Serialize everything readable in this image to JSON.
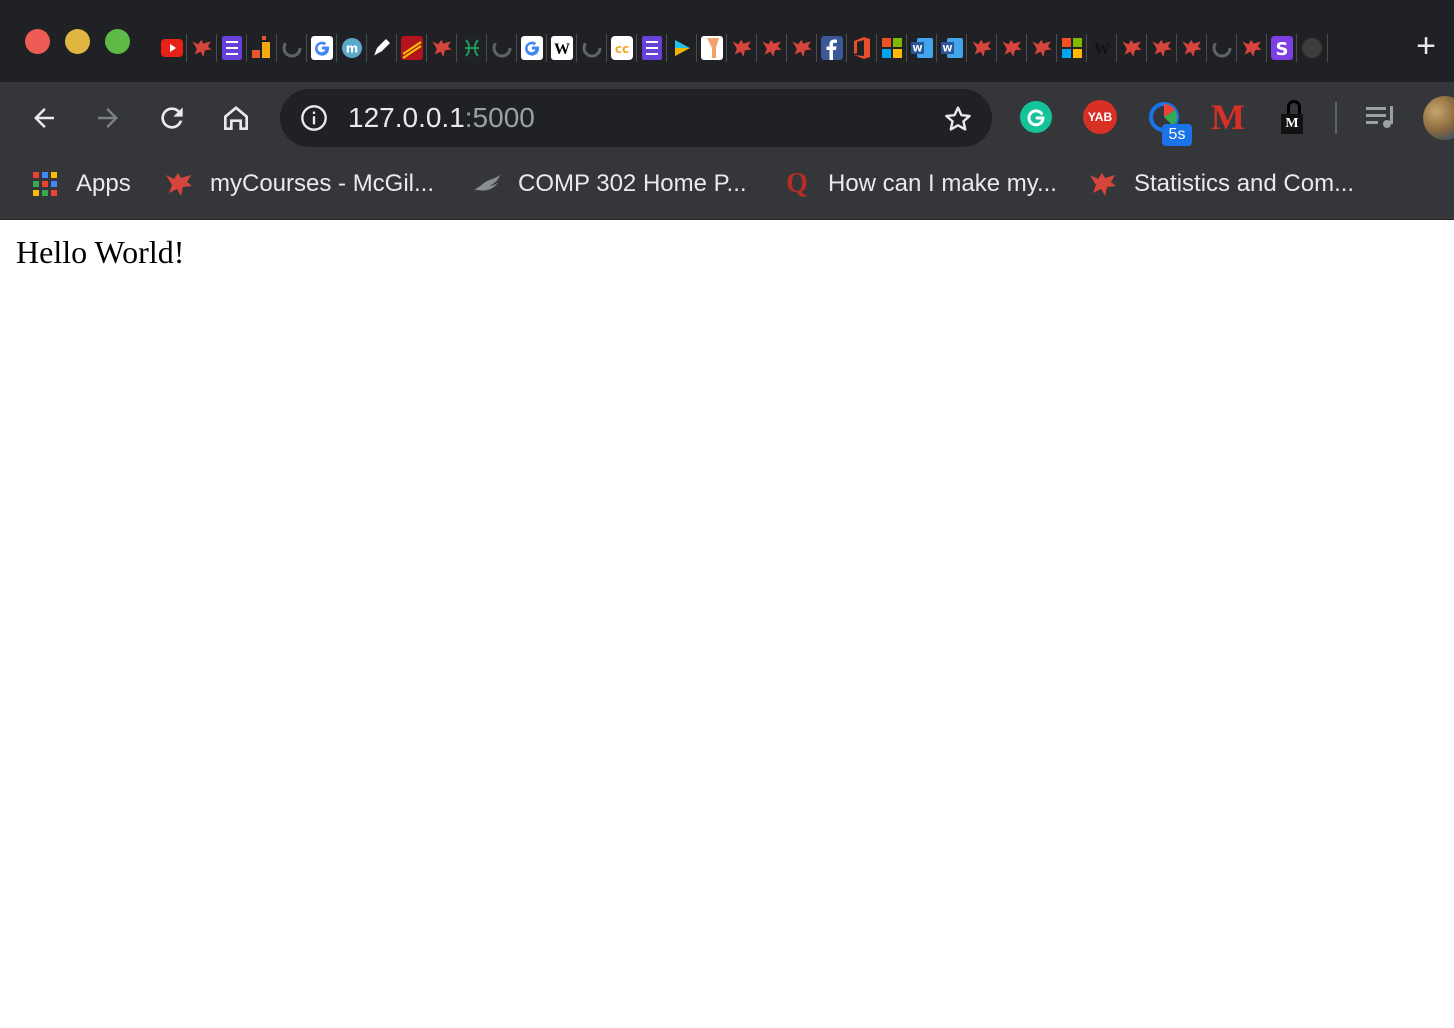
{
  "window": {
    "controls": [
      "close",
      "minimize",
      "zoom"
    ]
  },
  "tabs": [
    {
      "icon": "youtube-icon",
      "color": "#e62117"
    },
    {
      "icon": "mcgill-icon",
      "color": "#d6453c"
    },
    {
      "icon": "list-icon",
      "color": "#6741d9"
    },
    {
      "icon": "blocks-icon",
      "color": "#e4572e"
    },
    {
      "icon": "loading-icon",
      "color": "#5f6368"
    },
    {
      "icon": "google-icon",
      "color": "#4285f4"
    },
    {
      "icon": "m-circle-icon",
      "color": "#5aa9c8"
    },
    {
      "icon": "pen-icon",
      "color": "#ffffff"
    },
    {
      "icon": "cibc-icon",
      "color": "#b3141e"
    },
    {
      "icon": "mcgill-icon",
      "color": "#d6453c"
    },
    {
      "icon": "pisces-icon",
      "color": "#1f9c5a"
    },
    {
      "icon": "loading-icon",
      "color": "#5f6368"
    },
    {
      "icon": "google-icon",
      "color": "#4285f4"
    },
    {
      "icon": "wikipedia-icon",
      "color": "#ffffff"
    },
    {
      "icon": "loading-icon",
      "color": "#5f6368"
    },
    {
      "icon": "cc-icon",
      "color": "#f5a623"
    },
    {
      "icon": "list-icon",
      "color": "#6741d9"
    },
    {
      "icon": "play-icon",
      "color": "#22c3e6"
    },
    {
      "icon": "y-icon",
      "color": "#f4a26b"
    },
    {
      "icon": "mcgill-icon",
      "color": "#d6453c"
    },
    {
      "icon": "mcgill-icon",
      "color": "#d6453c"
    },
    {
      "icon": "mcgill-icon",
      "color": "#d6453c"
    },
    {
      "icon": "facebook-icon",
      "color": "#3b5998"
    },
    {
      "icon": "office-icon",
      "color": "#e4502a"
    },
    {
      "icon": "microsoft-icon",
      "color": "#f25022"
    },
    {
      "icon": "word-icon",
      "color": "#2b579a"
    },
    {
      "icon": "word-icon",
      "color": "#2b579a"
    },
    {
      "icon": "mcgill-icon",
      "color": "#d6453c"
    },
    {
      "icon": "mcgill-icon",
      "color": "#d6453c"
    },
    {
      "icon": "mcgill-icon",
      "color": "#d6453c"
    },
    {
      "icon": "microsoft-icon",
      "color": "#f25022"
    },
    {
      "icon": "journal-icon",
      "color": "#111111"
    },
    {
      "icon": "mcgill-icon",
      "color": "#d6453c"
    },
    {
      "icon": "mcgill-icon",
      "color": "#d6453c"
    },
    {
      "icon": "mcgill-icon",
      "color": "#d6453c"
    },
    {
      "icon": "loading-icon",
      "color": "#5f6368"
    },
    {
      "icon": "mcgill-icon",
      "color": "#d6453c"
    },
    {
      "icon": "s-icon",
      "color": "#7b3fe4"
    },
    {
      "icon": "incognito-icon",
      "color": "#3c3c3c"
    }
  ],
  "toolbar": {
    "url_host": "127.0.0.1",
    "url_port": ":5000",
    "extensions": [
      {
        "icon": "grammarly-icon",
        "color": "#15c39a"
      },
      {
        "icon": "yab-icon",
        "label": "YAB",
        "color": "#d93025"
      },
      {
        "icon": "timer-icon",
        "badge": "5s",
        "color": "#1a73e8"
      },
      {
        "icon": "m-icon",
        "label": "M",
        "color": "#d93025"
      },
      {
        "icon": "lock-m-icon",
        "label": "M",
        "color": "#000000"
      },
      {
        "icon": "media-queue-icon",
        "color": "#9aa0a6"
      }
    ]
  },
  "bookmarks": [
    {
      "label": "Apps",
      "icon": "apps-icon"
    },
    {
      "label": "myCourses - McGil...",
      "icon": "mcgill-icon"
    },
    {
      "label": "COMP 302 Home P...",
      "icon": "bird-icon"
    },
    {
      "label": "How can I make my...",
      "icon": "quora-icon"
    },
    {
      "label": "Statistics and Com...",
      "icon": "mcgill-icon"
    }
  ],
  "page": {
    "body_text": "Hello World!"
  },
  "colors": {
    "tabstrip": "#202124",
    "toolbar": "#35363a",
    "omnibox": "#202124",
    "text": "#e8eaed"
  }
}
